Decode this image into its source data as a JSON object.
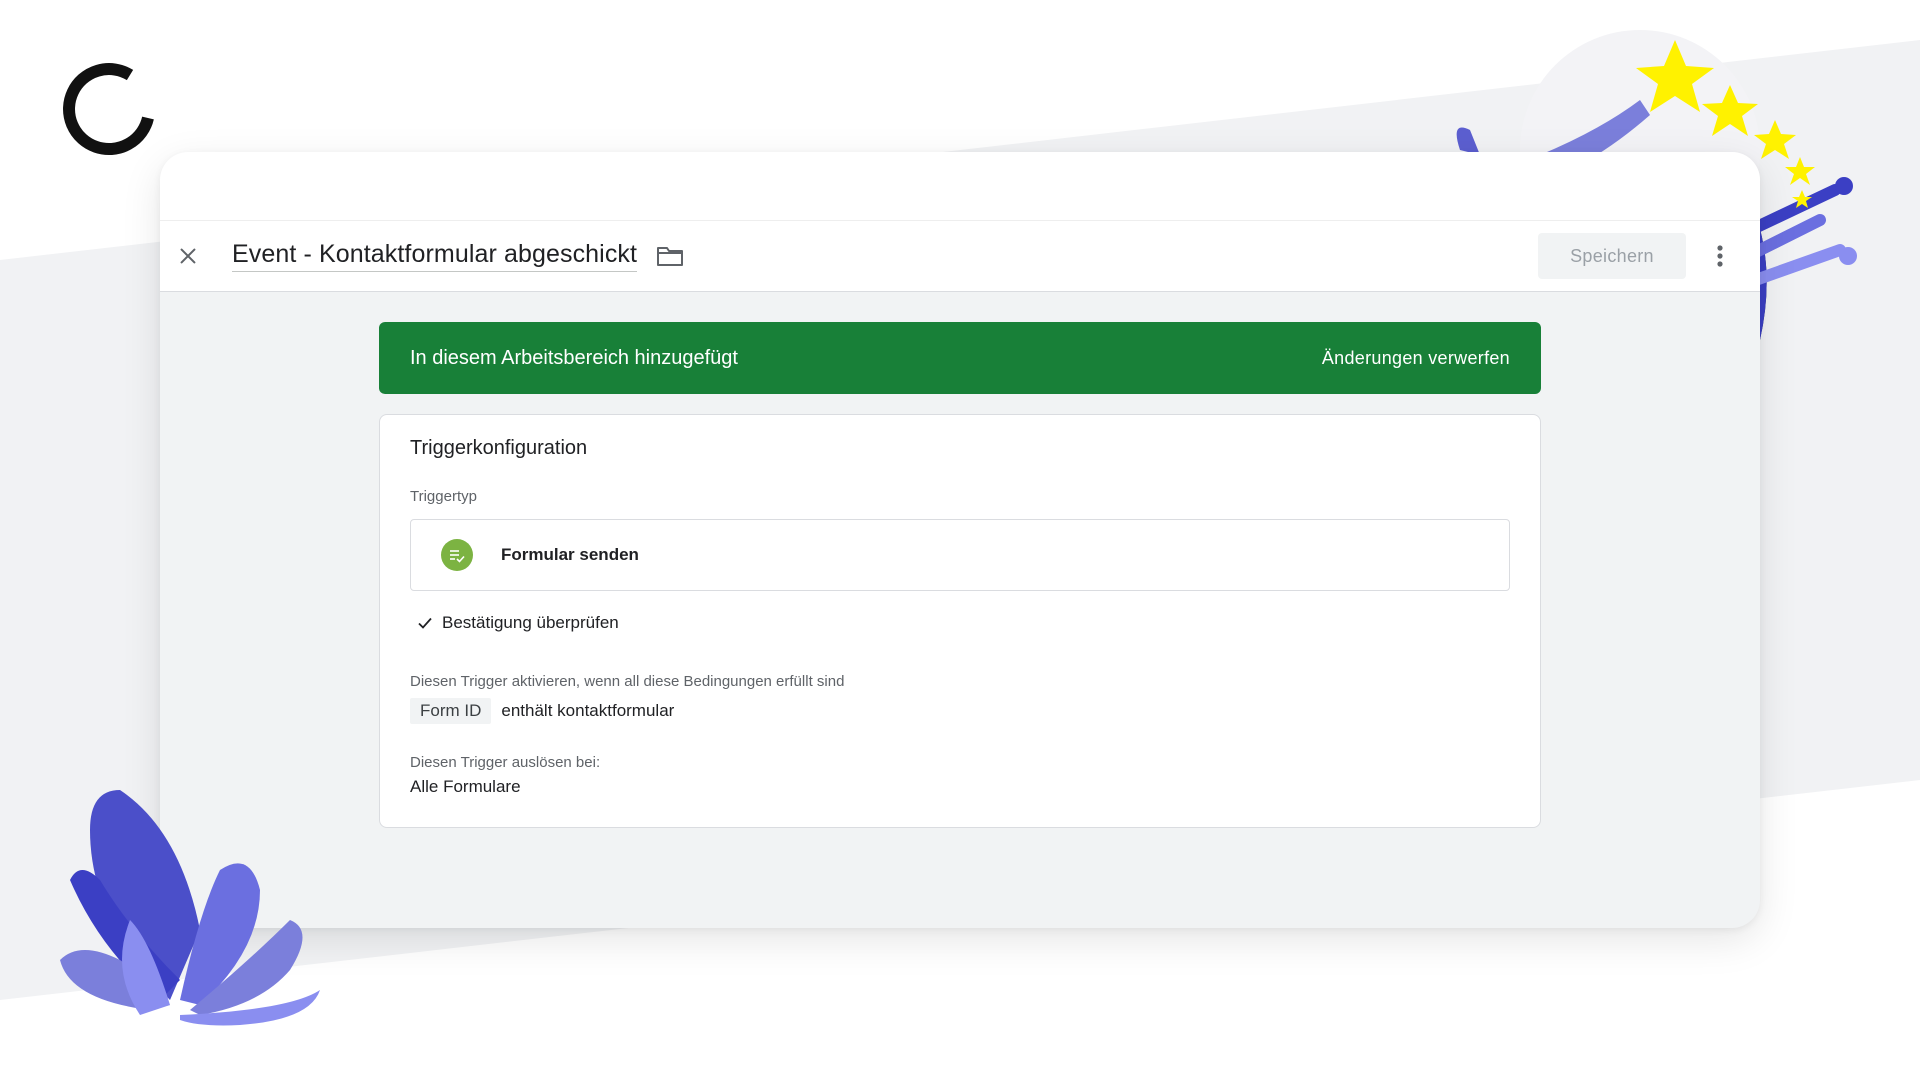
{
  "toolbar": {
    "title": "Event - Kontaktformular abgeschickt",
    "save_label": "Speichern",
    "close_icon": "close-icon",
    "folder_icon": "folder-icon",
    "more_icon": "more-vert-icon"
  },
  "banner": {
    "text": "In diesem Arbeitsbereich hinzugefügt",
    "action_label": "Änderungen verwerfen",
    "color": "#188038"
  },
  "trigger_config": {
    "title": "Triggerkonfiguration",
    "trigger_type_label": "Triggertyp",
    "trigger_type_name": "Formular senden",
    "trigger_type_icon": "form-submit-icon",
    "trigger_type_icon_color": "#7cb342",
    "check_validation_label": "Bestätigung überprüfen",
    "conditions_label": "Diesen Trigger aktivieren, wenn all diese Bedingungen erfüllt sind",
    "condition": {
      "variable": "Form ID",
      "operator_value": "enthält kontaktformular"
    },
    "fire_on_label": "Diesen Trigger auslösen bei:",
    "fire_on_value": "Alle Formulare"
  },
  "colors": {
    "accent_green": "#188038",
    "save_disabled_text": "#9aa0a6",
    "deco_purple": "#7b7fdb",
    "deco_yellow": "#fff200"
  }
}
